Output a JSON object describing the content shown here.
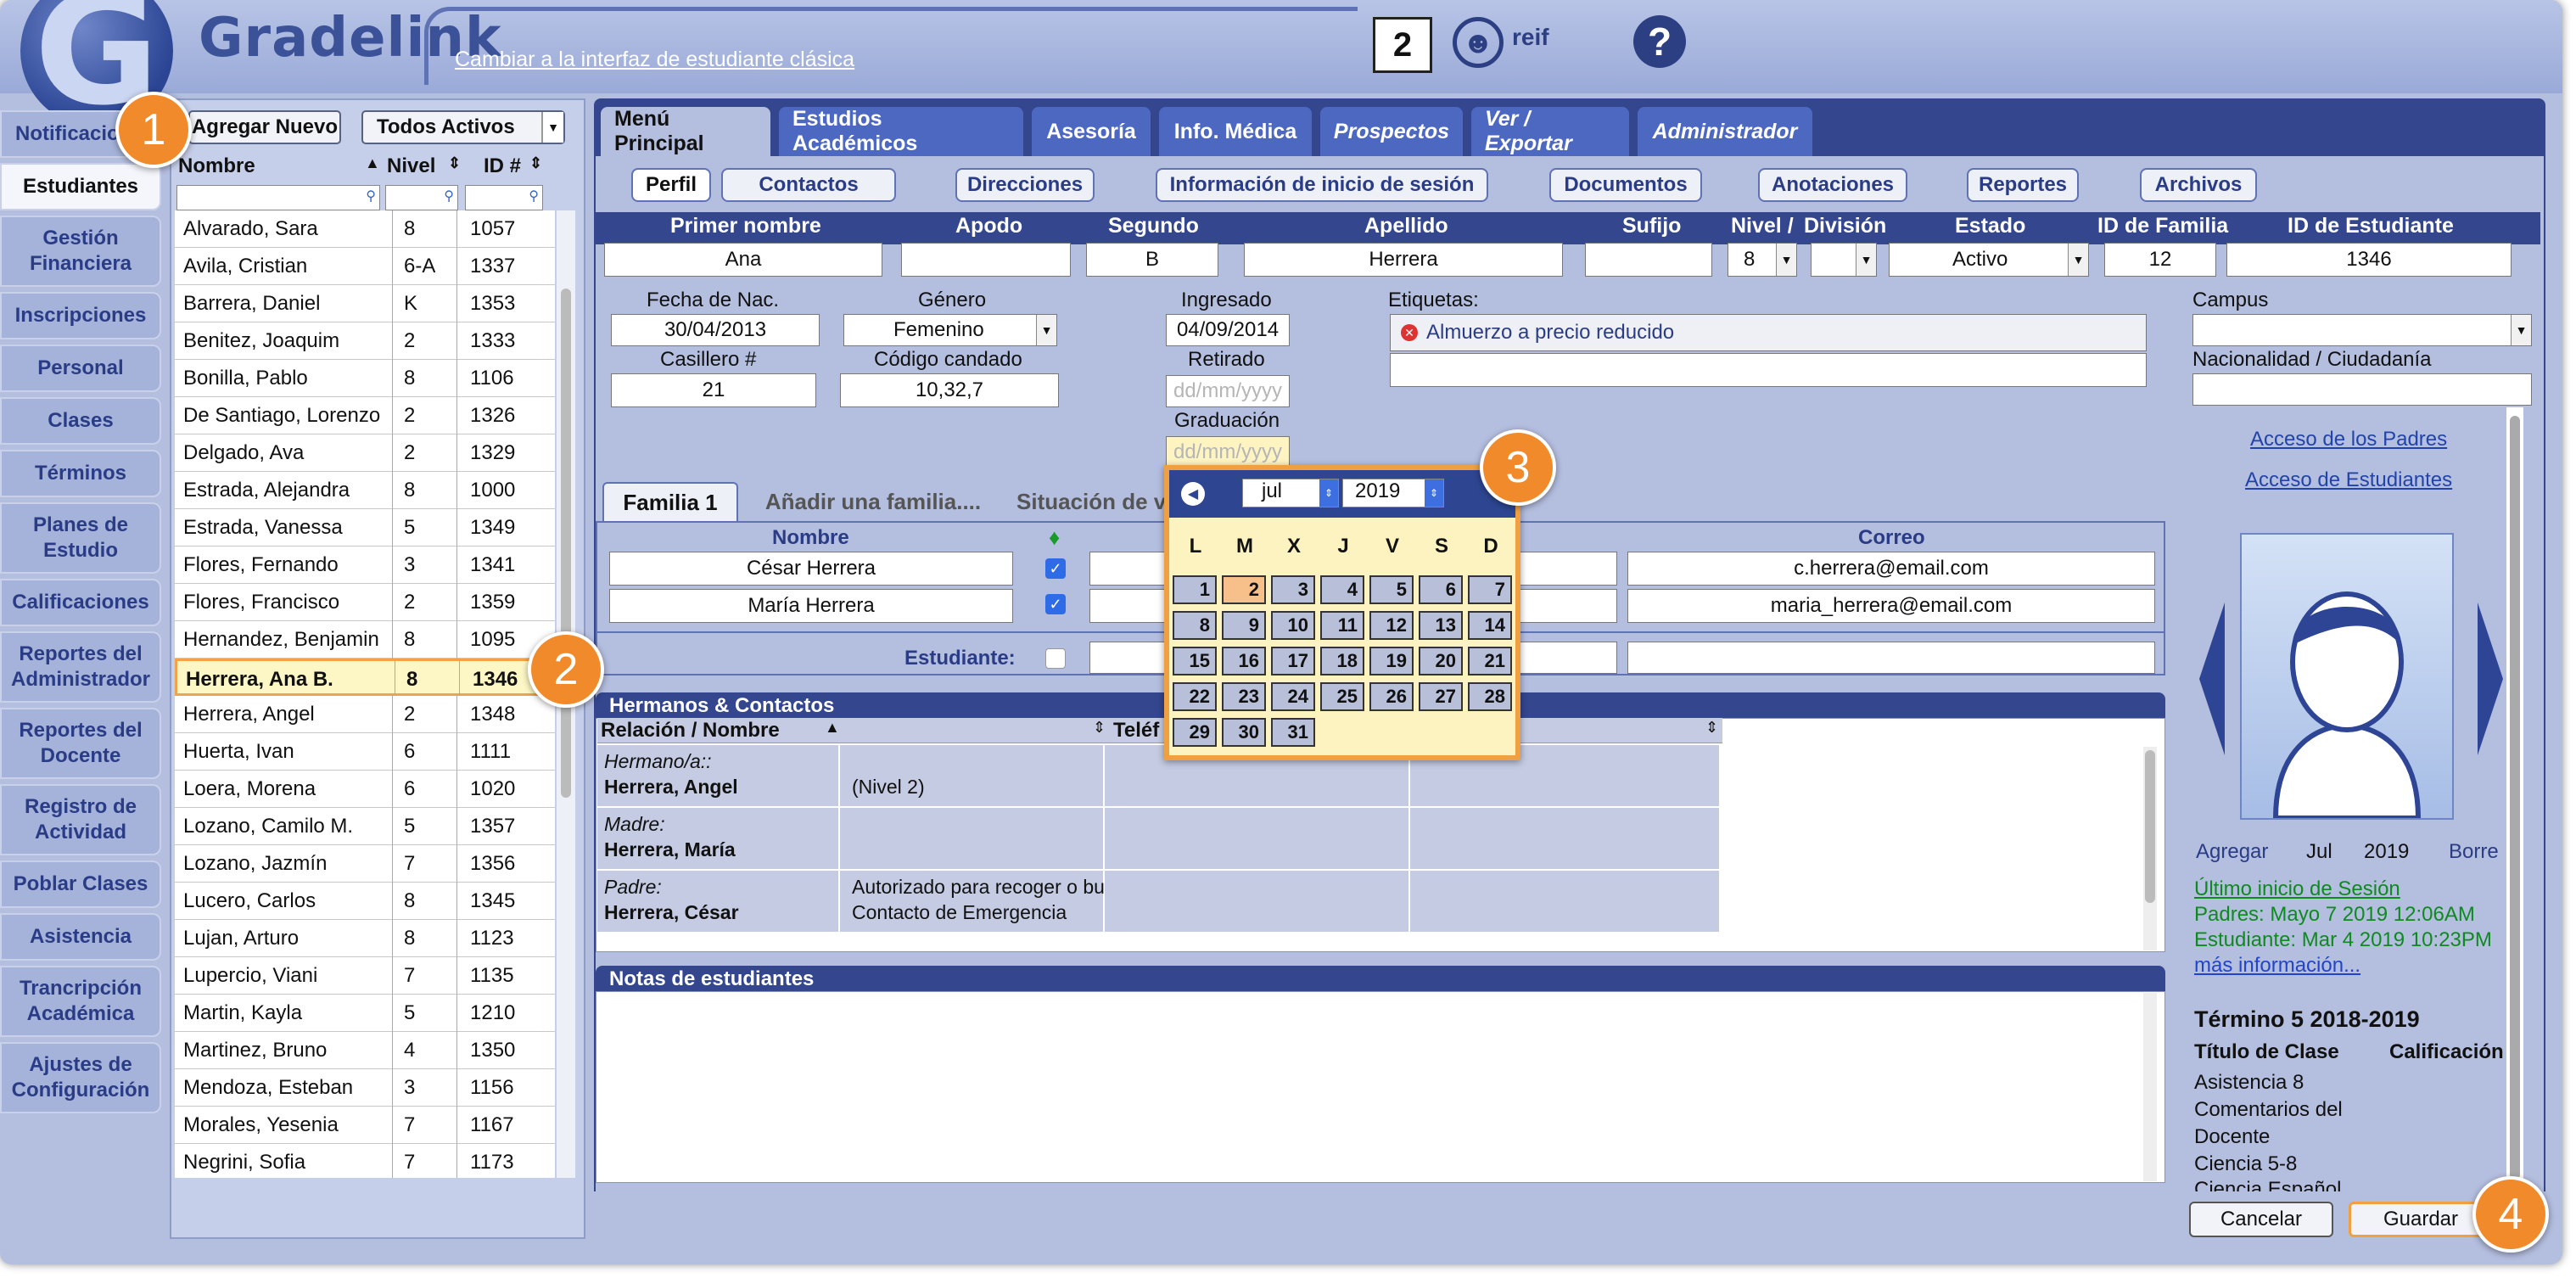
{
  "header": {
    "logo": "Gradelink",
    "classic_link": "Cambiar a la interfaz de estudiante clásica",
    "calendar_day": "2",
    "username": "reif",
    "help": "?"
  },
  "nav": [
    "Notificaciones",
    "Estudiantes",
    "Gestión Financiera",
    "Inscripciones",
    "Personal",
    "Clases",
    "Términos",
    "Planes de Estudio",
    "Calificaciones",
    "Reportes del Administrador",
    "Reportes del Docente",
    "Registro de Actividad",
    "Poblar Clases",
    "Asistencia",
    "Trancripción Académica",
    "Ajustes de Configuración"
  ],
  "list": {
    "add_label": "Agregar Nuevo",
    "filter": "Todos Activos",
    "col_name": "Nombre",
    "col_level": "Nivel",
    "col_id": "ID #",
    "rows": [
      [
        "Alvarado, Sara",
        "8",
        "1057"
      ],
      [
        "Avila, Cristian",
        "6-A",
        "1337"
      ],
      [
        "Barrera, Daniel",
        "K",
        "1353"
      ],
      [
        "Benitez, Joaquim",
        "2",
        "1333"
      ],
      [
        "Bonilla, Pablo",
        "8",
        "1106"
      ],
      [
        "De Santiago, Lorenzo",
        "2",
        "1326"
      ],
      [
        "Delgado, Ava",
        "2",
        "1329"
      ],
      [
        "Estrada, Alejandra",
        "8",
        "1000"
      ],
      [
        "Estrada, Vanessa",
        "5",
        "1349"
      ],
      [
        "Flores, Fernando",
        "3",
        "1341"
      ],
      [
        "Flores, Francisco",
        "2",
        "1359"
      ],
      [
        "Hernandez, Benjamin",
        "8",
        "1095"
      ],
      [
        "Herrera, Ana B.",
        "8",
        "1346"
      ],
      [
        "Herrera, Angel",
        "2",
        "1348"
      ],
      [
        "Huerta, Ivan",
        "6",
        "1111"
      ],
      [
        "Loera, Morena",
        "6",
        "1020"
      ],
      [
        "Lozano, Camilo M.",
        "5",
        "1357"
      ],
      [
        "Lozano, Jazmín",
        "7",
        "1356"
      ],
      [
        "Lucero, Carlos",
        "8",
        "1345"
      ],
      [
        "Lujan, Arturo",
        "8",
        "1123"
      ],
      [
        "Lupercio, Viani",
        "7",
        "1135"
      ],
      [
        "Martin, Kayla",
        "5",
        "1210"
      ],
      [
        "Martinez, Bruno",
        "4",
        "1350"
      ],
      [
        "Mendoza, Esteban",
        "3",
        "1156"
      ],
      [
        "Morales, Yesenia",
        "7",
        "1167"
      ],
      [
        "Negrini, Sofia",
        "7",
        "1173"
      ]
    ]
  },
  "tabs": [
    "Menú Principal",
    "Estudios Académicos",
    "Asesoría",
    "Info. Médica",
    "Prospectos",
    "Ver / Exportar",
    "Administrador"
  ],
  "subtabs": [
    "Perfil",
    "Contactos",
    "Direcciones",
    "Información de inicio de sesión",
    "Documentos",
    "Anotaciones",
    "Reportes",
    "Archivos"
  ],
  "profile": {
    "labels": {
      "first": "Primer nombre",
      "nick": "Apodo",
      "middle": "Segundo",
      "last": "Apellido",
      "suffix": "Sufijo",
      "level": "Nivel /",
      "division": "División",
      "status": "Estado",
      "family_id": "ID de Familia",
      "student_id": "ID de Estudiante"
    },
    "values": {
      "first": "Ana",
      "nick": "",
      "middle": "B",
      "last": "Herrera",
      "suffix": "",
      "level": "8",
      "division": "",
      "status": "Activo",
      "family_id": "12",
      "student_id": "1346"
    },
    "dob_label": "Fecha de Nac.",
    "dob": "30/04/2013",
    "gender_label": "Género",
    "gender": "Femenino",
    "entered_label": "Ingresado",
    "entered": "04/09/2014",
    "locker_label": "Casillero #",
    "locker": "21",
    "lock_label": "Código candado",
    "lock": "10,32,7",
    "withdrawn_label": "Retirado",
    "withdrawn_ph": "dd/mm/yyyy",
    "grad_label": "Graduación",
    "grad_ph": "dd/mm/yyyy",
    "tags_label": "Etiquetas:",
    "tag": "Almuerzo a precio reducido",
    "campus_label": "Campus",
    "nationality_label": "Nacionalidad / Ciudadanía"
  },
  "family": {
    "tab1": "Familia 1",
    "add": "Añadir una familia....",
    "situation": "Situación de v",
    "col_name": "Nombre",
    "col_email": "Correo",
    "student_label": "Estudiante:",
    "members": [
      {
        "name": "César Herrera",
        "email": "c.herrera@email.com"
      },
      {
        "name": "María Herrera",
        "email": "maria_herrera@email.com"
      }
    ]
  },
  "siblings": {
    "title": "Hermanos & Contactos",
    "col_rel": "Relación / Nombre",
    "col_phone": "Teléf",
    "rows": [
      {
        "rel": "Hermano/a::",
        "name": "Herrera, Angel",
        "info": "(Nivel 2)",
        "info2": ""
      },
      {
        "rel": "Madre:",
        "name": "Herrera, María",
        "info": "",
        "info2": ""
      },
      {
        "rel": "Padre:",
        "name": "Herrera, César",
        "info": "Autorizado para recoger o bu",
        "info2": "Contacto de Emergencia"
      }
    ]
  },
  "notes": {
    "title": "Notas de estudiantes"
  },
  "right": {
    "parents_link": "Acceso de los Padres",
    "students_link": "Acceso de Estudiantes",
    "photo_add": "Agregar",
    "photo_month": "Jul",
    "photo_year": "2019",
    "photo_del": "Borre",
    "last_login": "Último inicio de Sesión",
    "parents_login": "Padres: Mayo 7 2019 12:06AM",
    "student_login": "Estudiante: Mar 4 2019 10:23PM",
    "more": "más información...",
    "term": "Término 5 2018-2019",
    "col_class": "Título de Clase",
    "col_grade": "Calificación",
    "classes": [
      "Asistencia 8",
      "Comentarios del",
      "Docente",
      "Ciencia 5-8",
      "Ciencia Español"
    ]
  },
  "buttons": {
    "cancel": "Cancelar",
    "save": "Guardar"
  },
  "calendar": {
    "month": "jul",
    "year": "2019",
    "weekdays": [
      "L",
      "M",
      "X",
      "J",
      "V",
      "S",
      "D"
    ],
    "days": [
      "1",
      "2",
      "3",
      "4",
      "5",
      "6",
      "7",
      "8",
      "9",
      "10",
      "11",
      "12",
      "13",
      "14",
      "15",
      "16",
      "17",
      "18",
      "19",
      "20",
      "21",
      "22",
      "23",
      "24",
      "25",
      "26",
      "27",
      "28",
      "29",
      "30",
      "31"
    ],
    "today": "2"
  },
  "badges": [
    "1",
    "2",
    "3",
    "4"
  ],
  "colors": {
    "navy": "#33468e",
    "accent": "#f08a2a",
    "panel": "#b4bedf"
  }
}
